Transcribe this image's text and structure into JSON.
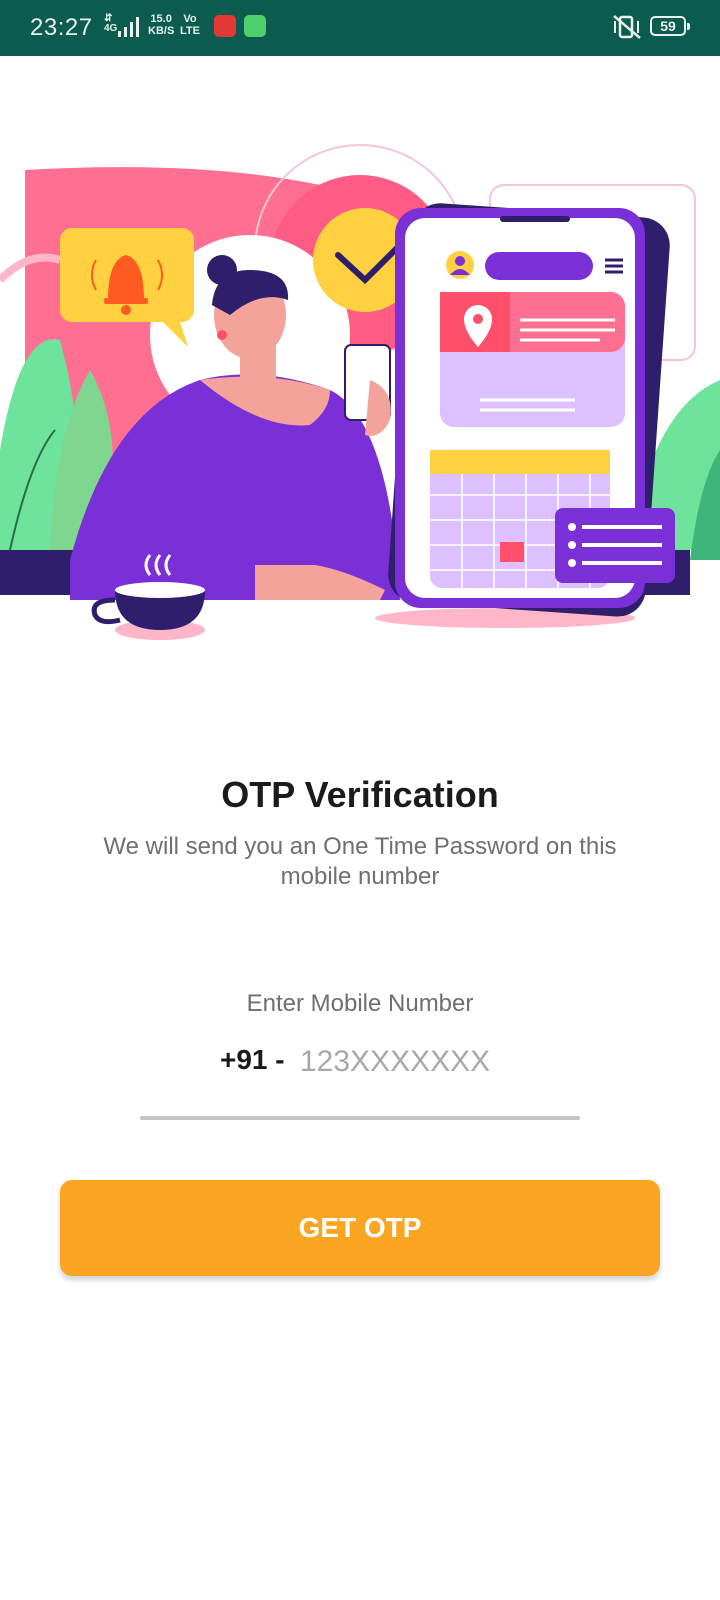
{
  "status_bar": {
    "time": "23:27",
    "network_type": "4G",
    "speed_value": "15.0",
    "speed_unit": "KB/S",
    "volte_top": "Vo",
    "volte_bottom": "LTE",
    "battery": "59",
    "icons": [
      "signal-icon",
      "app-notification-icon",
      "app-notification-icon",
      "vibrate-icon",
      "battery-icon"
    ]
  },
  "illustration": {
    "description_icon": "otp-illustration"
  },
  "header": {
    "title": "OTP Verification",
    "subtitle": "We will send you an One Time Password on this mobile number"
  },
  "form": {
    "label": "Enter Mobile Number",
    "country_code": "+91 -",
    "phone_placeholder": "123XXXXXXX",
    "phone_value": ""
  },
  "actions": {
    "get_otp_label": "GET OTP"
  },
  "colors": {
    "status_bar": "#0b5b4e",
    "button": "#fca523",
    "purple": "#7b2fd6",
    "pink": "#ff6f91"
  }
}
